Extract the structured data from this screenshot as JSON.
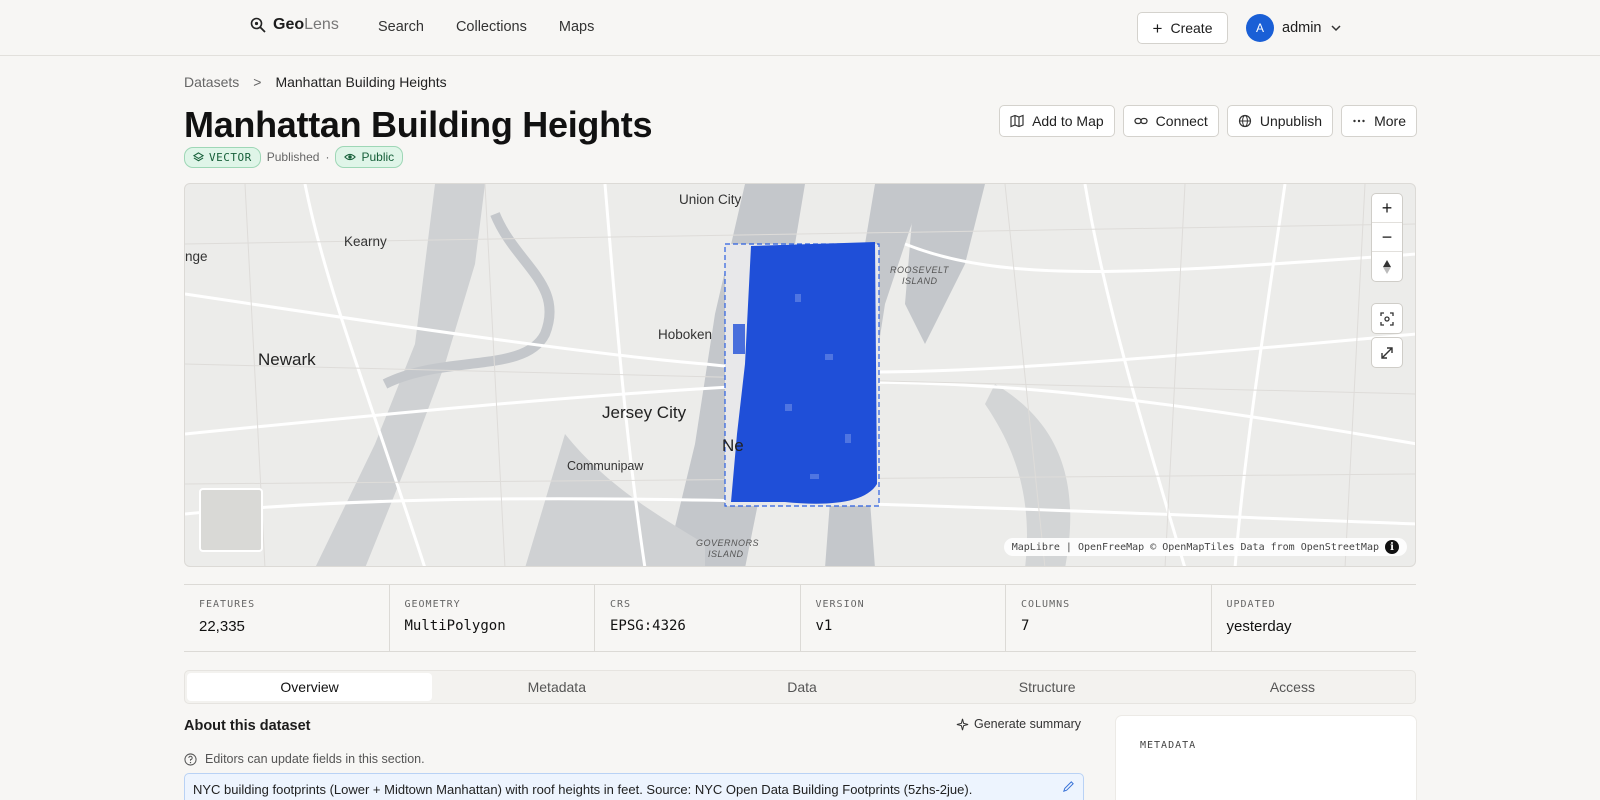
{
  "app": {
    "logo_bold": "Geo",
    "logo_light": "Lens"
  },
  "nav": [
    {
      "label": "Search"
    },
    {
      "label": "Collections"
    },
    {
      "label": "Maps"
    }
  ],
  "header_actions": {
    "create_label": "Create",
    "avatar_initial": "A",
    "user_name": "admin"
  },
  "breadcrumb": {
    "root": "Datasets",
    "separator": ">",
    "current": "Manhattan Building Heights"
  },
  "dataset": {
    "title": "Manhattan Building Heights",
    "type_badge": "VECTOR",
    "status": "Published",
    "separator": "·",
    "visibility": "Public"
  },
  "actions": [
    {
      "label": "Add to Map",
      "icon": "map-icon"
    },
    {
      "label": "Connect",
      "icon": "link-icon"
    },
    {
      "label": "Unpublish",
      "icon": "globe-off-icon"
    },
    {
      "label": "More",
      "icon": "more-icon"
    }
  ],
  "map": {
    "place_labels": [
      "Union City",
      "Kearny",
      "nge",
      "Newark",
      "Hoboken",
      "Jersey City",
      "Communipaw",
      "Ne",
      "ROOSEVELT",
      "ISLAND",
      "GOVERNORS",
      "ISLAND"
    ],
    "attribution": "MapLibre | OpenFreeMap © OpenMapTiles Data from OpenStreetMap",
    "info_glyph": "i",
    "footprint_color": "#1f4fd8"
  },
  "stats": [
    {
      "label": "FEATURES",
      "value": "22,335"
    },
    {
      "label": "GEOMETRY",
      "value": "MultiPolygon"
    },
    {
      "label": "CRS",
      "value": "EPSG:4326"
    },
    {
      "label": "VERSION",
      "value": "v1"
    },
    {
      "label": "COLUMNS",
      "value": "7"
    },
    {
      "label": "UPDATED",
      "value": "yesterday"
    }
  ],
  "tabs": [
    {
      "label": "Overview",
      "active": true
    },
    {
      "label": "Metadata"
    },
    {
      "label": "Data"
    },
    {
      "label": "Structure"
    },
    {
      "label": "Access"
    }
  ],
  "about": {
    "heading": "About this dataset",
    "generate_label": "Generate summary",
    "hint": "Editors can update fields in this section.",
    "description": "NYC building footprints (Lower + Midtown Manhattan) with roof heights in feet. Source: NYC Open Data Building Footprints (5zhs-2jue)."
  },
  "side_panel": {
    "label": "METADATA"
  }
}
